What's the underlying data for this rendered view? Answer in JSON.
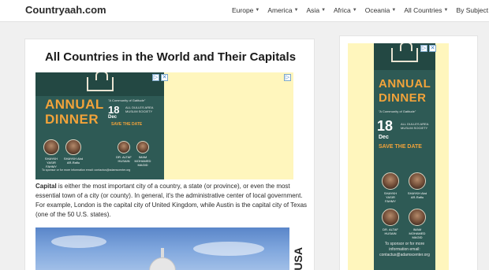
{
  "site": {
    "logo": "Countryaah.com"
  },
  "nav": [
    {
      "label": "Europe"
    },
    {
      "label": "America"
    },
    {
      "label": "Asia"
    },
    {
      "label": "Africa"
    },
    {
      "label": "Oceania"
    },
    {
      "label": "All Countries"
    },
    {
      "label": "By Subject"
    }
  ],
  "icons": {
    "caret": "chevron-down-icon",
    "ad_info": "info-icon",
    "ad_close": "close-icon"
  },
  "main": {
    "title": "All Countries in the World and Their Capitals",
    "paragraph_lead": "Capital",
    "paragraph_rest": " is either the most important city of a country, a state (or province),  or even the most essential town of a city (or county). In general, it's the administrative center of local government. For example, London is the capital city of United Kingdom, while Austin is the capital city of Texas (one of the 50 U.S. states).",
    "photo_label": "USA"
  },
  "ad": {
    "org": "adams",
    "word1": "ANNUAL",
    "word2": "DINNER",
    "tagline": "\"A Community of Gatitude\"",
    "day": "18",
    "month": "Dec",
    "venue": "ALL DULLES AREA MUSLIM SOCIETY",
    "save": "SAVE THE DATE",
    "speakers": [
      "SHAYKH YASIR FAHMY",
      "SHAYKH Abd AR-Rafiu",
      "DR. ALTAF HUSAIN",
      "IMAM MOHAMED MAGID"
    ],
    "contact": "To sponsor or for more information email: contactus@adamscenter.org"
  },
  "colors": {
    "accent": "#f2a33a",
    "poster_bg": "#2e5a55",
    "ad_bg": "#fff6bd"
  }
}
